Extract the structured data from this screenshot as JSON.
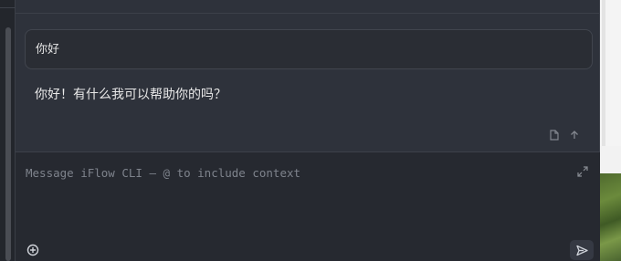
{
  "conversation": {
    "user_message": "你好",
    "assistant_message": "你好！有什么我可以帮助你的吗？"
  },
  "message_actions": [
    {
      "icon": "file-icon"
    },
    {
      "icon": "arrow-up-icon"
    }
  ],
  "composer": {
    "placeholder": "Message iFlow CLI — @ to include context",
    "value": "",
    "expand_icon": "expand-icon",
    "add_context_icon": "add-context-icon",
    "send_icon": "send-icon"
  },
  "colors": {
    "panel_bg": "#2e323b",
    "input_bg": "#262930",
    "text": "#e8e8e8",
    "muted": "#7e838c"
  }
}
